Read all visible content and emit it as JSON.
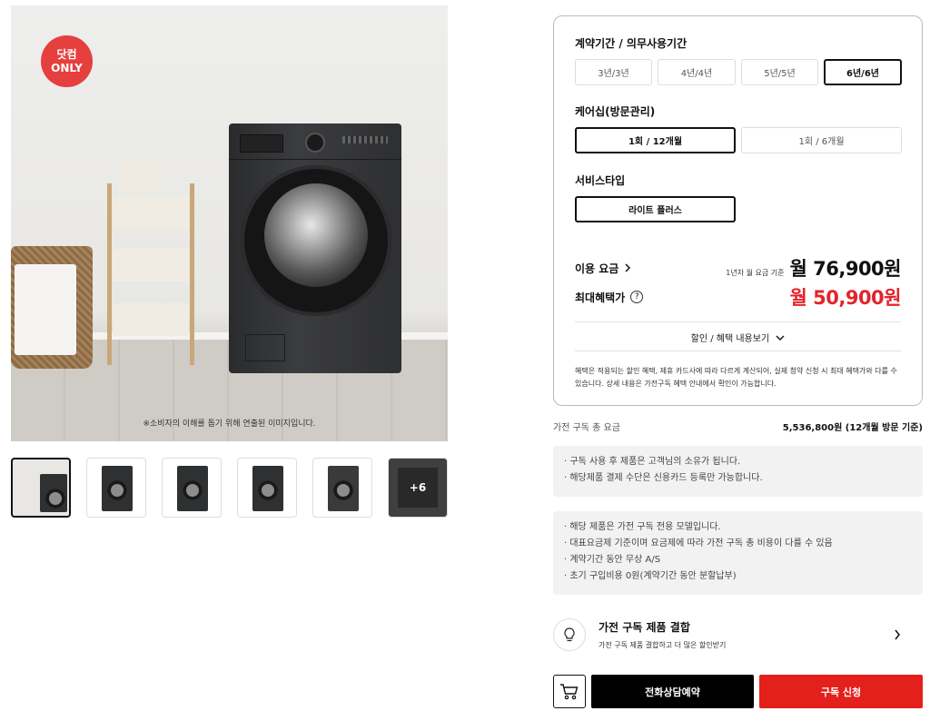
{
  "gallery": {
    "badge_line1": "닷컴",
    "badge_line2": "ONLY",
    "caption": "※소비자의 이해를 돕기 위해 연출된 이미지입니다.",
    "more_count": "+6",
    "thumbnails": [
      "scene",
      "front",
      "front",
      "angle",
      "open-door",
      "more"
    ]
  },
  "options": {
    "contract_title": "계약기간 / 의무사용기간",
    "contract_options": [
      "3년/3년",
      "4년/4년",
      "5년/5년",
      "6년/6년"
    ],
    "contract_selected": "6년/6년",
    "care_title": "케어십(방문관리)",
    "care_options": [
      "1회 / 12개월",
      "1회 / 6개월"
    ],
    "care_selected": "1회 / 12개월",
    "service_title": "서비스타입",
    "service_options": [
      "라이트 플러스"
    ],
    "service_selected": "라이트 플러스"
  },
  "pricing": {
    "fee_label": "이용 요금",
    "fee_note": "1년차 월 요금 기준",
    "fee_value": "월 76,900원",
    "max_label": "최대혜택가",
    "max_value": "월 50,900원",
    "discount_link": "할인 / 혜택 내용보기",
    "notice": "혜택은 적용되는 할인 혜택, 제휴 카드사에 따라 다르게 계산되어, 실제 청약 신청 시 최대 혜택가와 다를 수 있습니다. 상세 내용은 가전구독 혜택 안내에서 확인이 가능합니다."
  },
  "total": {
    "label": "가전 구독 총 요금",
    "value": "5,536,800원 (12개월 방문 기준)"
  },
  "info1": [
    "구독 사용 후 제품은 고객님의 소유가 됩니다.",
    "해당제품 결제 수단은 신용카드 등록만 가능합니다."
  ],
  "info2": [
    "해당 제품은 가전 구독 전용 모델입니다.",
    "대표요금제 기준이며 요금제에 따라 가전 구독 총 비용이 다를 수 있음",
    "계약기간 동안 무상 A/S",
    "초기 구입비용 0원(계약기간 동안 분할납부)"
  ],
  "combo": {
    "title": "가전 구독 제품 결합",
    "subtitle": "가전 구독 제품 결합하고 더 많은 할인받기"
  },
  "actions": {
    "call_label": "전화상담예약",
    "subscribe_label": "구독 신청"
  },
  "colors": {
    "accent_red": "#e3242b",
    "badge_red": "#e5403d",
    "black": "#000000"
  }
}
